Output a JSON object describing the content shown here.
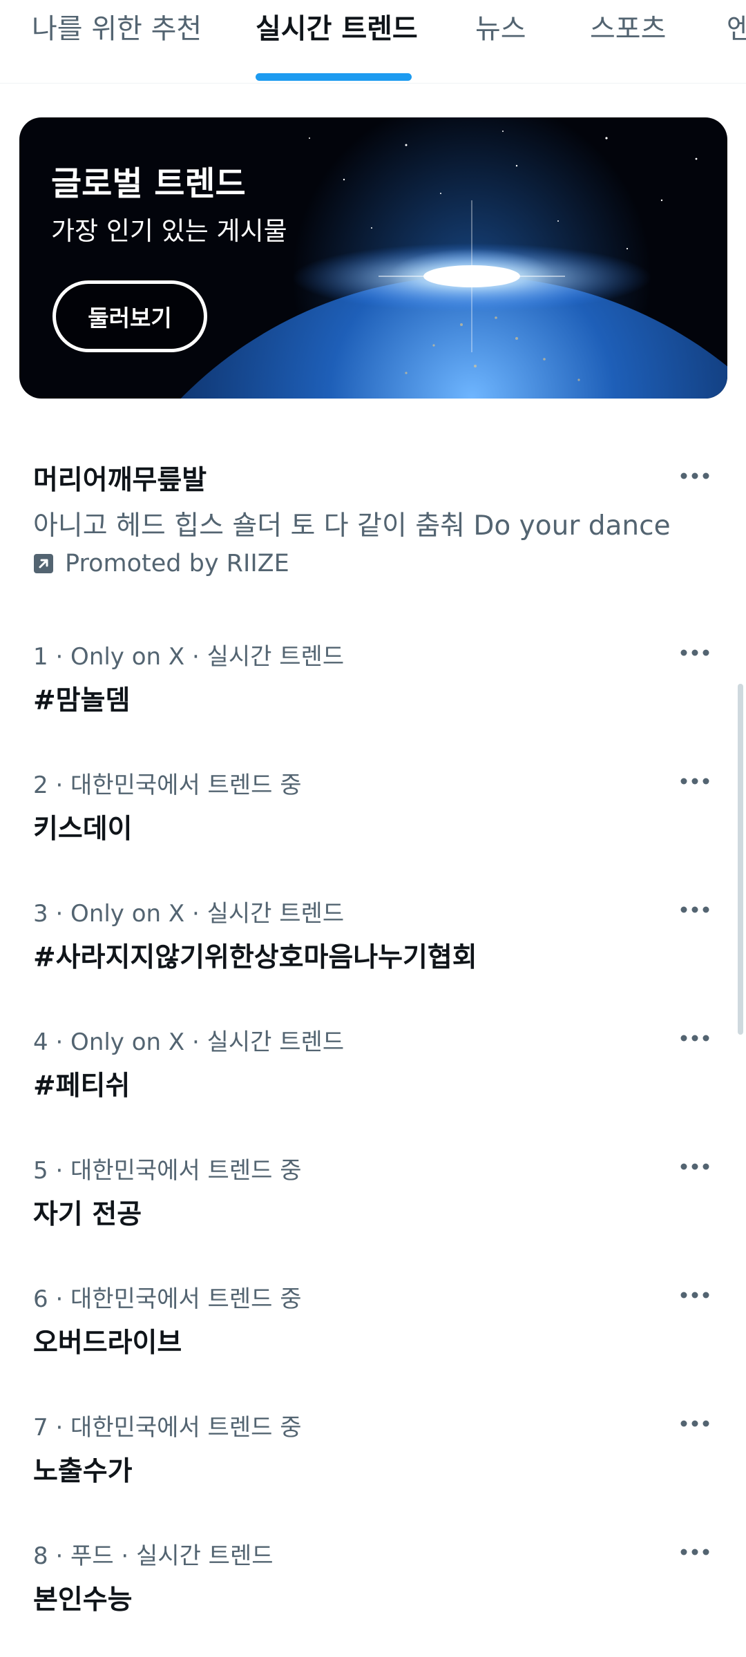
{
  "tabs": [
    {
      "label": "나를 위한 추천"
    },
    {
      "label": "실시간 트렌드"
    },
    {
      "label": "뉴스"
    },
    {
      "label": "스포츠"
    },
    {
      "label": "엔"
    }
  ],
  "colors": {
    "accent": "#1d9bf0",
    "text_primary": "#0f1419",
    "text_secondary": "#536471"
  },
  "banner": {
    "title": "글로벌 트렌드",
    "subtitle": "가장 인기 있는 게시물",
    "button_label": "둘러보기"
  },
  "promoted": {
    "title": "머리어깨무릎발",
    "description": "아니고 헤드 힙스 숄더 토 다 같이 춤춰 Do your dance",
    "promoted_by": "Promoted by RIIZE",
    "icon": "promoted-arrow-icon"
  },
  "trends": [
    {
      "meta": "1 · Only on X · 실시간 트렌드",
      "name": "#맘놀뎀"
    },
    {
      "meta": "2 · 대한민국에서 트렌드 중",
      "name": "키스데이"
    },
    {
      "meta": "3 · Only on X · 실시간 트렌드",
      "name": "#사라지지않기위한상호마음나누기협회"
    },
    {
      "meta": "4 · Only on X · 실시간 트렌드",
      "name": "#페티쉬"
    },
    {
      "meta": "5 · 대한민국에서 트렌드 중",
      "name": "자기 전공"
    },
    {
      "meta": "6 · 대한민국에서 트렌드 중",
      "name": "오버드라이브"
    },
    {
      "meta": "7 · 대한민국에서 트렌드 중",
      "name": "노출수가"
    },
    {
      "meta": "8 · 푸드 · 실시간 트렌드",
      "name": "본인수능"
    }
  ]
}
